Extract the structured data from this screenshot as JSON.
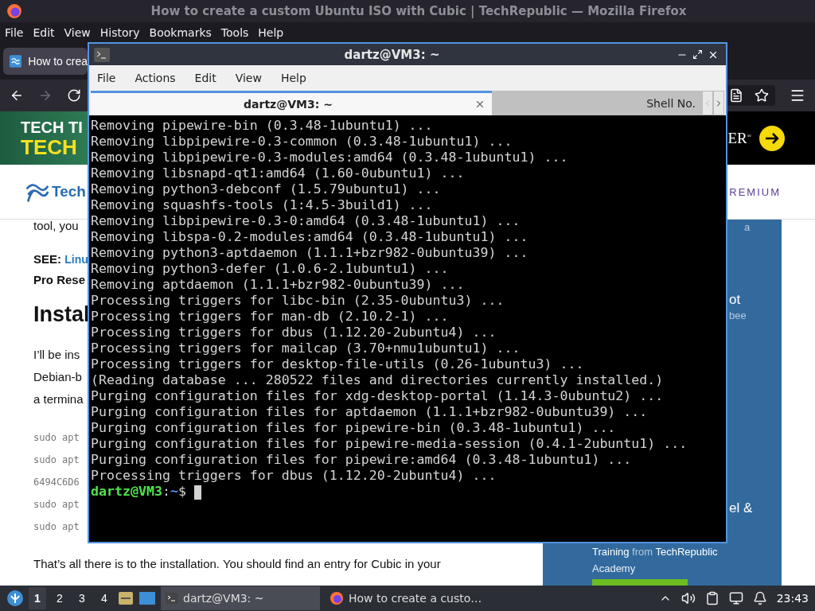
{
  "firefox": {
    "title": "How to create a custom Ubuntu ISO with Cubic | TechRepublic — Mozilla Firefox",
    "menu": [
      "File",
      "Edit",
      "View",
      "History",
      "Bookmarks",
      "Tools",
      "Help"
    ],
    "tab": {
      "label": "How to crea"
    }
  },
  "page": {
    "banner": {
      "line1": "TECH TI",
      "line2": "TECH",
      "brand": "ER$^{®}$"
    },
    "header": {
      "logo": "Tech",
      "premium": "REMIUM"
    },
    "article": {
      "intro": "tool, you",
      "see": {
        "label": "SEE:",
        "link": "Linu"
      },
      "pro": "Pro Rese",
      "heading": "Instal",
      "para": [
        "I’ll be ins",
        "Debian-b",
        "a termina"
      ],
      "code": [
        "sudo apt",
        "sudo apt",
        "6494C6D6",
        "sudo apt",
        "sudo apt"
      ],
      "outro": "That’s all there is to the installation. You should find an entry for Cubic in your"
    },
    "sidebar": {
      "fragments": [
        {
          "kind": "caption",
          "text": "a"
        },
        {
          "kind": "title",
          "text": "ot"
        },
        {
          "kind": "sub",
          "text": "bee"
        },
        {
          "kind": "title",
          "text": "el &"
        }
      ],
      "training": [
        {
          "text": "Training",
          "muted": false
        },
        {
          "text": "from",
          "muted": true
        },
        {
          "text": "TechRepublic",
          "muted": false
        }
      ],
      "academy": "Academy"
    }
  },
  "terminal": {
    "title": "dartz@VM3: ~",
    "menu": [
      "File",
      "Actions",
      "Edit",
      "View",
      "Help"
    ],
    "tabs": [
      {
        "label": "dartz@VM3: ~",
        "selected": true
      },
      {
        "label": "Shell No.",
        "selected": false
      }
    ],
    "scroll_left_disabled": true,
    "lines": [
      "Removing pipewire-bin (0.3.48-1ubuntu1) ...",
      "Removing libpipewire-0.3-common (0.3.48-1ubuntu1) ...",
      "Removing libpipewire-0.3-modules:amd64 (0.3.48-1ubuntu1) ...",
      "Removing libsnapd-qt1:amd64 (1.60-0ubuntu1) ...",
      "Removing python3-debconf (1.5.79ubuntu1) ...",
      "Removing squashfs-tools (1:4.5-3build1) ...",
      "Removing libpipewire-0.3-0:amd64 (0.3.48-1ubuntu1) ...",
      "Removing libspa-0.2-modules:amd64 (0.3.48-1ubuntu1) ...",
      "Removing python3-aptdaemon (1.1.1+bzr982-0ubuntu39) ...",
      "Removing python3-defer (1.0.6-2.1ubuntu1) ...",
      "Removing aptdaemon (1.1.1+bzr982-0ubuntu39) ...",
      "Processing triggers for libc-bin (2.35-0ubuntu3) ...",
      "Processing triggers for man-db (2.10.2-1) ...",
      "Processing triggers for dbus (1.12.20-2ubuntu4) ...",
      "Processing triggers for mailcap (3.70+nmu1ubuntu1) ...",
      "Processing triggers for desktop-file-utils (0.26-1ubuntu3) ...",
      "(Reading database ... 280522 files and directories currently installed.)",
      "Purging configuration files for xdg-desktop-portal (1.14.3-0ubuntu2) ...",
      "Purging configuration files for aptdaemon (1.1.1+bzr982-0ubuntu39) ...",
      "Purging configuration files for pipewire-bin (0.3.48-1ubuntu1) ...",
      "Purging configuration files for pipewire-media-session (0.4.1-2ubuntu1) ...",
      "Purging configuration files for pipewire:amd64 (0.3.48-1ubuntu1) ...",
      "Processing triggers for dbus (1.12.20-2ubuntu4) ..."
    ],
    "prompt": {
      "user_host": "dartz@VM3",
      "sep": ":",
      "path": "~",
      "symbol": "$"
    }
  },
  "taskbar": {
    "workspaces": [
      {
        "label": "1",
        "selected": true
      },
      {
        "label": "2",
        "selected": false
      },
      {
        "label": "3",
        "selected": false
      },
      {
        "label": "4",
        "selected": false
      }
    ],
    "tasks": [
      {
        "kind": "terminal",
        "label": "dartz@VM3: ~",
        "selected": true
      },
      {
        "kind": "browser",
        "label": "How to create a custo…",
        "selected": false
      }
    ],
    "clock": "23:43"
  }
}
